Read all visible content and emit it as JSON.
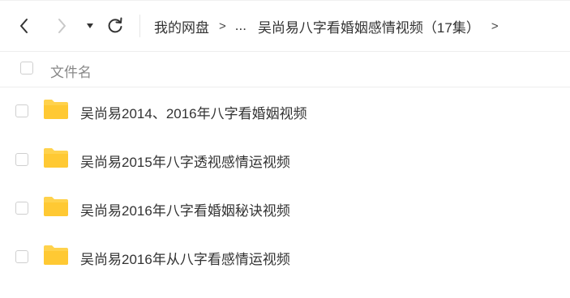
{
  "toolbar": {
    "breadcrumb": {
      "root": "我的网盘",
      "ellipsis": "...",
      "current": "吴尚易八字看婚姻感情视频（17集）",
      "separator": ">"
    }
  },
  "icons": {
    "back": "chevron-left-icon",
    "forward": "chevron-right-icon",
    "history": "caret-down-icon",
    "refresh": "refresh-icon",
    "folder": "folder-icon"
  },
  "colors": {
    "folder": "#FFD24C",
    "text": "#333333",
    "muted": "#888888"
  },
  "list": {
    "header": {
      "name_label": "文件名"
    },
    "items": [
      {
        "name": "吴尚易2014、2016年八字看婚姻视频",
        "type": "folder"
      },
      {
        "name": "吴尚易2015年八字透视感情运视频",
        "type": "folder"
      },
      {
        "name": "吴尚易2016年八字看婚姻秘诀视频",
        "type": "folder"
      },
      {
        "name": "吴尚易2016年从八字看感情运视频",
        "type": "folder"
      }
    ]
  }
}
